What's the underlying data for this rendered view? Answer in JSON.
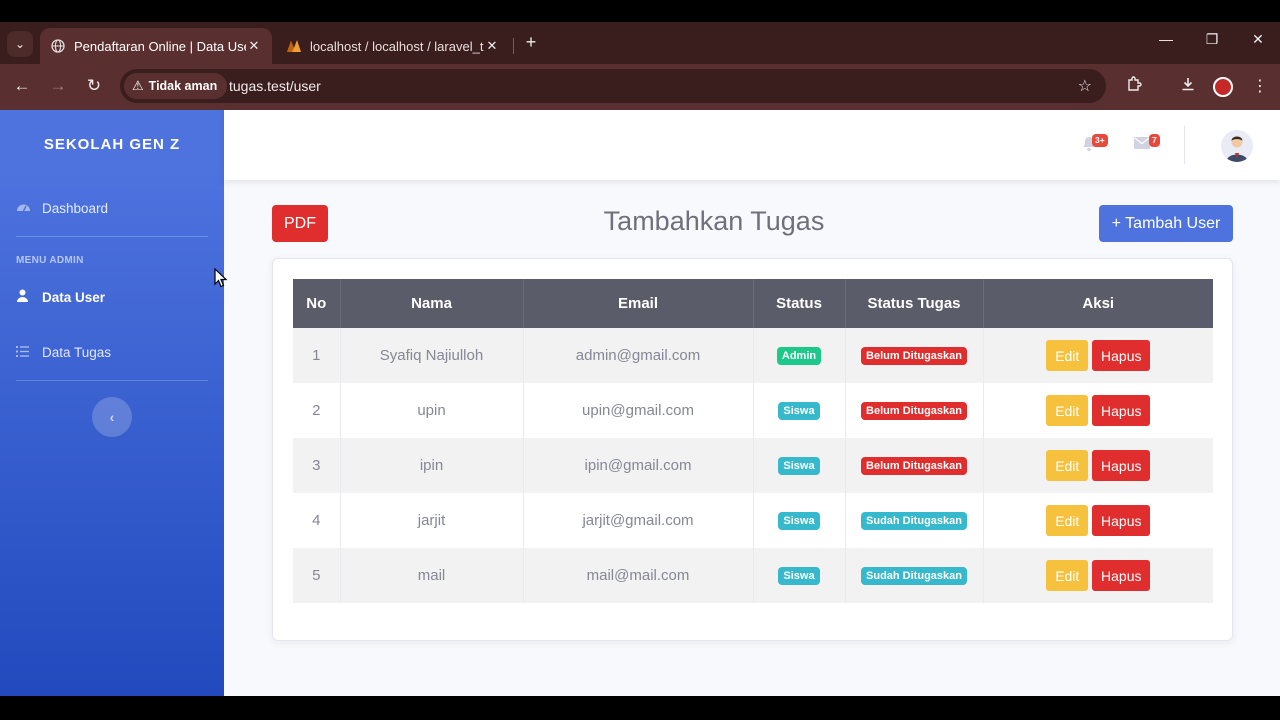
{
  "browser": {
    "tabs": [
      {
        "title": "Pendaftaran Online | Data User",
        "active": true
      },
      {
        "title": "localhost / localhost / laravel_tu",
        "active": false
      }
    ],
    "security_label": "Tidak aman",
    "url": "tugas.test/user"
  },
  "sidebar": {
    "brand": "SEKOLAH GEN Z",
    "dashboard_label": "Dashboard",
    "heading": "MENU ADMIN",
    "items": [
      {
        "label": "Data User",
        "active": true
      },
      {
        "label": "Data Tugas",
        "active": false
      }
    ]
  },
  "topbar": {
    "alerts_badge": "3+",
    "messages_badge": "7"
  },
  "main": {
    "pdf_button": "PDF",
    "title": "Tambahkan Tugas",
    "add_button": "+ Tambah User"
  },
  "table": {
    "headers": [
      "No",
      "Nama",
      "Email",
      "Status",
      "Status Tugas",
      "Aksi"
    ],
    "edit_label": "Edit",
    "delete_label": "Hapus",
    "rows": [
      {
        "no": "1",
        "nama": "Syafiq Najiulloh",
        "email": "admin@gmail.com",
        "status": "Admin",
        "status_tugas": "Belum Ditugaskan"
      },
      {
        "no": "2",
        "nama": "upin",
        "email": "upin@gmail.com",
        "status": "Siswa",
        "status_tugas": "Belum Ditugaskan"
      },
      {
        "no": "3",
        "nama": "ipin",
        "email": "ipin@gmail.com",
        "status": "Siswa",
        "status_tugas": "Belum Ditugaskan"
      },
      {
        "no": "4",
        "nama": "jarjit",
        "email": "jarjit@gmail.com",
        "status": "Siswa",
        "status_tugas": "Sudah Ditugaskan"
      },
      {
        "no": "5",
        "nama": "mail",
        "email": "mail@mail.com",
        "status": "Siswa",
        "status_tugas": "Sudah Ditugaskan"
      }
    ]
  },
  "colors": {
    "sidebar": "#4e73df",
    "danger": "#e02d2d",
    "success": "#1cc88a",
    "info": "#36b9cc",
    "warning": "#f6c23e",
    "table_header": "#5a5c69"
  }
}
